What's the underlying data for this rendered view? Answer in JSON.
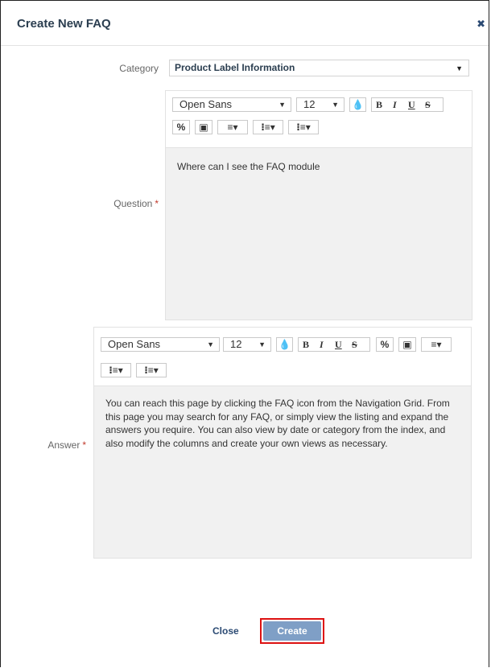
{
  "dialog": {
    "title": "Create New FAQ",
    "close_icon": "close-icon"
  },
  "category": {
    "label": "Category",
    "value": "Product Label Information"
  },
  "question": {
    "label": "Question",
    "required_mark": "*",
    "text": "Where can I see the FAQ module"
  },
  "answer": {
    "label": "Answer",
    "required_mark": "*",
    "text": "You can reach this page by clicking the FAQ icon from the Navigation Grid. From this page you may search for any FAQ, or simply view the listing and expand the answers you require. You can also view by date or category from the index, and also modify the columns and create your own views as necessary."
  },
  "toolbar": {
    "font": "Open Sans",
    "size": "12",
    "bold": "B",
    "italic": "I",
    "underline": "U",
    "strike": "S"
  },
  "footer": {
    "close_label": "Close",
    "create_label": "Create"
  },
  "colors": {
    "accent": "#7f9fc6",
    "title": "#2b3e50",
    "required": "#c0392b",
    "highlight_border": "#dd1111"
  }
}
